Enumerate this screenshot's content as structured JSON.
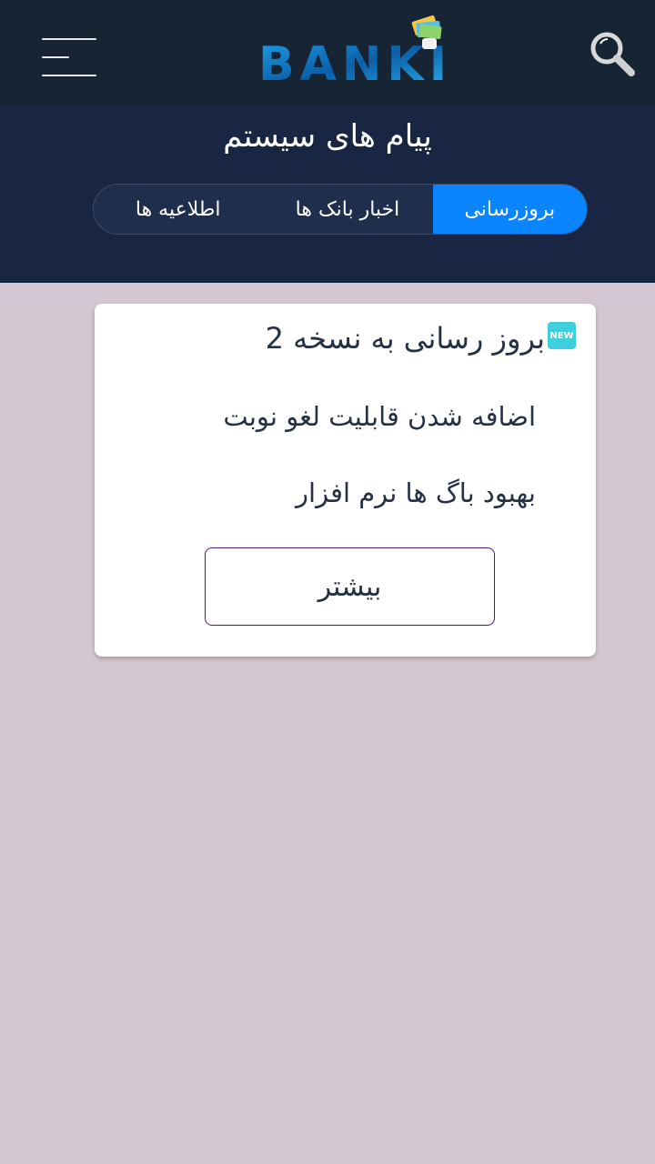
{
  "header": {
    "logo_text": "BANKI",
    "menu_icon": "hamburger-menu-icon",
    "search_icon": "search-icon",
    "bg_color": "#172434"
  },
  "page": {
    "title": "پیام های سیستم",
    "bg_color": "#192643"
  },
  "tabs": [
    {
      "label": "بروزرسانی",
      "active": true
    },
    {
      "label": "اخبار بانک ها",
      "active": false
    },
    {
      "label": "اطلاعیه ها",
      "active": false
    }
  ],
  "colors": {
    "accent": "#0a84ff",
    "badge": "#3ecfdc",
    "content_bg": "#d5c7d1",
    "button_border": "#4b1a7a"
  },
  "card": {
    "badge": "NEW",
    "title": "بروز رسانی به نسخه 2",
    "lines": [
      "اضافه شدن قابلیت لغو نوبت",
      "بهبود باگ ها نرم افزار"
    ],
    "more_label": "بیشتر"
  }
}
